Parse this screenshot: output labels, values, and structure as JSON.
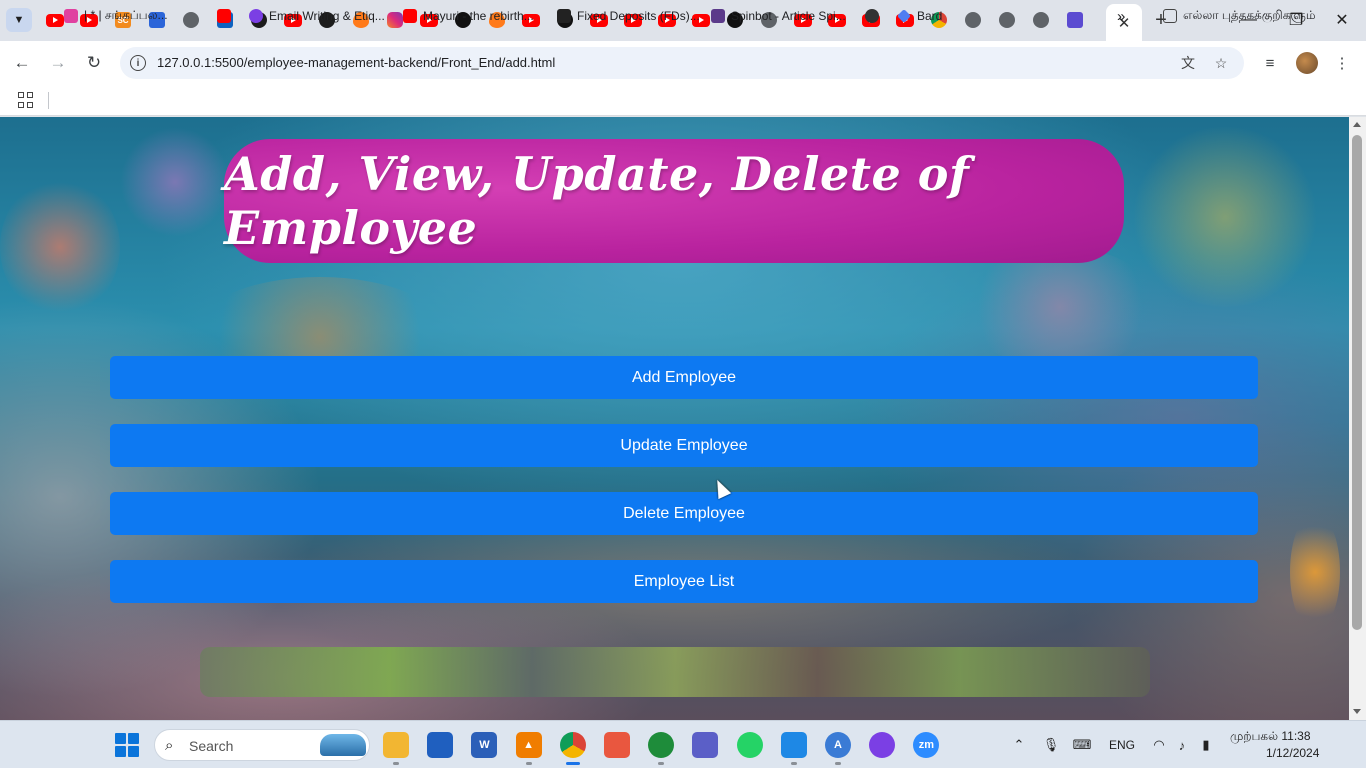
{
  "browser": {
    "tabs": [
      {
        "icon": "youtube-icon"
      },
      {
        "icon": "youtube-icon"
      },
      {
        "icon": "sc-icon",
        "glyph": "SC"
      },
      {
        "icon": "blue-app-icon"
      },
      {
        "icon": "globe-icon"
      },
      {
        "icon": "azure-icon",
        "glyph": "A"
      },
      {
        "icon": "openai-icon"
      },
      {
        "icon": "youtube-icon"
      },
      {
        "icon": "app-icon"
      },
      {
        "icon": "flame-icon"
      },
      {
        "icon": "instagram-icon"
      },
      {
        "icon": "youtube-icon"
      },
      {
        "icon": "github-icon"
      },
      {
        "icon": "flame-icon"
      },
      {
        "icon": "youtube-icon"
      },
      {
        "icon": "github-icon"
      },
      {
        "icon": "youtube-icon"
      },
      {
        "icon": "youtube-icon"
      },
      {
        "icon": "youtube-icon"
      },
      {
        "icon": "youtube-icon"
      },
      {
        "icon": "github-icon"
      },
      {
        "icon": "globe-icon"
      },
      {
        "icon": "youtube-icon"
      },
      {
        "icon": "youtube-icon"
      },
      {
        "icon": "youtube-icon"
      },
      {
        "icon": "youtube-icon"
      },
      {
        "icon": "chrome-icon"
      },
      {
        "icon": "globe-icon"
      },
      {
        "icon": "globe-icon"
      },
      {
        "icon": "globe-icon"
      },
      {
        "icon": "document-icon"
      }
    ],
    "active_tab": {
      "close_glyph": "✕"
    },
    "new_tab_glyph": "+",
    "window_controls": {
      "minimize": "—",
      "restore": "❐",
      "close": "✕"
    },
    "nav": {
      "back": "←",
      "forward": "→",
      "reload": "↻"
    },
    "address_bar": {
      "url": "127.0.0.1:5500/employee-management-backend/Front_End/add.html"
    },
    "bookmarks": [
      {
        "label": "| * | சங்கப்பல...",
        "color": "#e040a0"
      },
      {
        "label": "",
        "color": "#ff0000"
      },
      {
        "label": "Email Writing & Etiq...",
        "color": "#7b3fe4"
      },
      {
        "label": "Mayuri - the rebirth...",
        "color": "#ff0000"
      },
      {
        "label": "Fixed Deposits (FDs)...",
        "color": "#222222"
      },
      {
        "label": "Spinbot - Article Spi...",
        "color": "#5b3a8a"
      },
      {
        "label": "",
        "color": "#333333"
      },
      {
        "label": "Bard",
        "color": "#4f7df2"
      }
    ],
    "bookmarks_overflow": "»",
    "all_bookmarks": "எல்லா புத்தகக்குறிகளும்"
  },
  "page": {
    "title": "Add, View, Update, Delete of Employee",
    "buttons": {
      "add": "Add Employee",
      "update": "Update Employee",
      "delete": "Delete Employee",
      "list": "Employee List"
    }
  },
  "taskbar": {
    "search_label": "Search",
    "language": "ENG",
    "time": "முற்பகல் 11:38",
    "date": "1/12/2024",
    "apps": [
      {
        "name": "file-explorer-icon",
        "color": "#f2b632",
        "glyph": ""
      },
      {
        "name": "store-icon",
        "color": "#1f5fbf",
        "glyph": ""
      },
      {
        "name": "word-icon",
        "color": "#2b5fb8",
        "glyph": "W"
      },
      {
        "name": "vlc-icon",
        "color": "#f07d00",
        "glyph": "▲"
      },
      {
        "name": "chrome-icon",
        "color": "#4285f4",
        "glyph": ""
      },
      {
        "name": "presentation-icon",
        "color": "#e9573f",
        "glyph": ""
      },
      {
        "name": "app-icon",
        "color": "#1e8c3a",
        "glyph": ""
      },
      {
        "name": "teams-icon",
        "color": "#5b5fc7",
        "glyph": ""
      },
      {
        "name": "whatsapp-icon",
        "color": "#25d366",
        "glyph": ""
      },
      {
        "name": "vscode-icon",
        "color": "#1e88e5",
        "glyph": ""
      },
      {
        "name": "app-icon",
        "color": "#3a7bd5",
        "glyph": "A"
      },
      {
        "name": "github-desktop-icon",
        "color": "#7b3fe4",
        "glyph": ""
      },
      {
        "name": "zoom-icon",
        "color": "#2d8cff",
        "glyph": "zm"
      }
    ]
  },
  "colors": {
    "button_bg": "#0d79f2",
    "banner_bg": "#b9239f"
  }
}
